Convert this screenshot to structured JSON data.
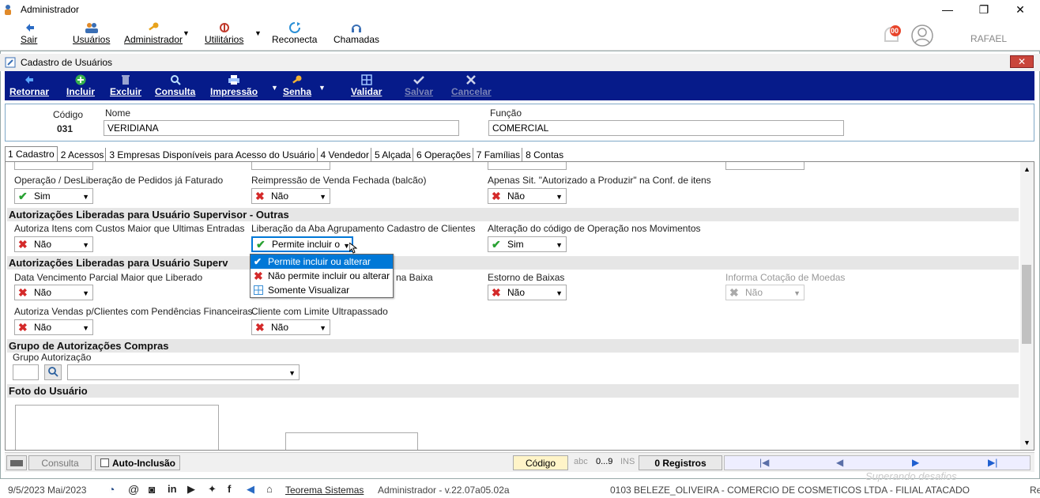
{
  "window": {
    "title": "Administrador"
  },
  "mainmenu": {
    "items": [
      {
        "label": "Sair",
        "icon": "exit-icon"
      },
      {
        "label": "Usuários",
        "icon": "users-icon"
      },
      {
        "label": "Administrador",
        "icon": "key-icon"
      },
      {
        "label": "Utilitários",
        "icon": "tools-icon"
      },
      {
        "label": "Reconecta",
        "icon": "refresh-icon"
      },
      {
        "label": "Chamadas",
        "icon": "headset-icon"
      }
    ],
    "notification_count": "00",
    "user": "RAFAEL"
  },
  "child": {
    "title": "Cadastro de Usuários",
    "close": "✕"
  },
  "toolbar": {
    "retornar": "Retornar",
    "incluir": "Incluir",
    "excluir": "Excluir",
    "consulta": "Consulta",
    "impressao": "Impressão",
    "senha": "Senha",
    "validar": "Validar",
    "salvar": "Salvar",
    "cancelar": "Cancelar"
  },
  "header": {
    "codigo_label": "Código",
    "codigo_value": "031",
    "nome_label": "Nome",
    "nome_value": "VERIDIANA",
    "funcao_label": "Função",
    "funcao_value": "COMERCIAL"
  },
  "tabs": [
    "1 Cadastro",
    "2 Acessos",
    "3 Empresas Disponíveis para Acesso do Usuário",
    "4 Vendedor",
    "5 Alçada",
    "6 Operações",
    "7 Famílias",
    "8 Contas"
  ],
  "form": {
    "op_deslib_label": "Operação / DesLiberação de Pedidos já Faturado",
    "op_deslib_value": "Sim",
    "reimpressao_label": "Reimpressão de Venda Fechada (balcão)",
    "reimpressao_value": "Não",
    "apenas_sit_label": "Apenas Sit. \"Autorizado a Produzir\" na Conf. de itens",
    "apenas_sit_value": "Não",
    "sec_outras": "Autorizações Liberadas para Usuário Supervisor - Outras",
    "autoriza_itens_label": "Autoriza Itens com Custos Maior que Ultimas Entradas",
    "autoriza_itens_value": "Não",
    "liberacao_aba_label": "Liberação da Aba Agrupamento Cadastro de Clientes",
    "liberacao_aba_value": "Permite incluir o",
    "alteracao_cod_label": "Alteração do código de Operação nos Movimentos",
    "alteracao_cod_value": "Sim",
    "sec_supervisor": "Autorizações Liberadas para Usuário Superv",
    "data_venc_label": "Data Vencimento Parcial Maior que Liberado",
    "data_venc_value": "Não",
    "baixa_label_tail": "na Baixa",
    "estorno_label": "Estorno de Baixas",
    "estorno_value": "Não",
    "informa_cot_label": "Informa Cotação de Moedas",
    "informa_cot_value": "Não",
    "autoriza_vendas_label": "Autoriza Vendas p/Clientes com Pendências Financeiras",
    "autoriza_vendas_value": "Não",
    "cliente_limite_label": "Cliente com Limite Ultrapassado",
    "cliente_limite_value": "Não",
    "sec_compras": "Grupo de Autorizações Compras",
    "grupo_aut_label": "Grupo Autorização",
    "sec_foto": "Foto do Usuário"
  },
  "dropdown_options": [
    "Permite incluir ou alterar",
    "Não permite incluir ou alterar",
    "Somente Visualizar"
  ],
  "status": {
    "consulta": "Consulta",
    "auto_inclusao": "Auto-Inclusão",
    "codigo": "Código",
    "abc": "abc",
    "range": "0...9",
    "ins": "INS",
    "registros": "0 Registros"
  },
  "footer": {
    "date": "9/5/2023 Mai/2023",
    "brand": "Teorema Sistemas",
    "version": "Administrador - v.22.07a05.02a",
    "company": "0103 BELEZE_OLIVEIRA - COMERCIO DE COSMETICOS LTDA - FILIAL ATACADO",
    "tail": "Re",
    "slogan": "Superando desafios"
  }
}
